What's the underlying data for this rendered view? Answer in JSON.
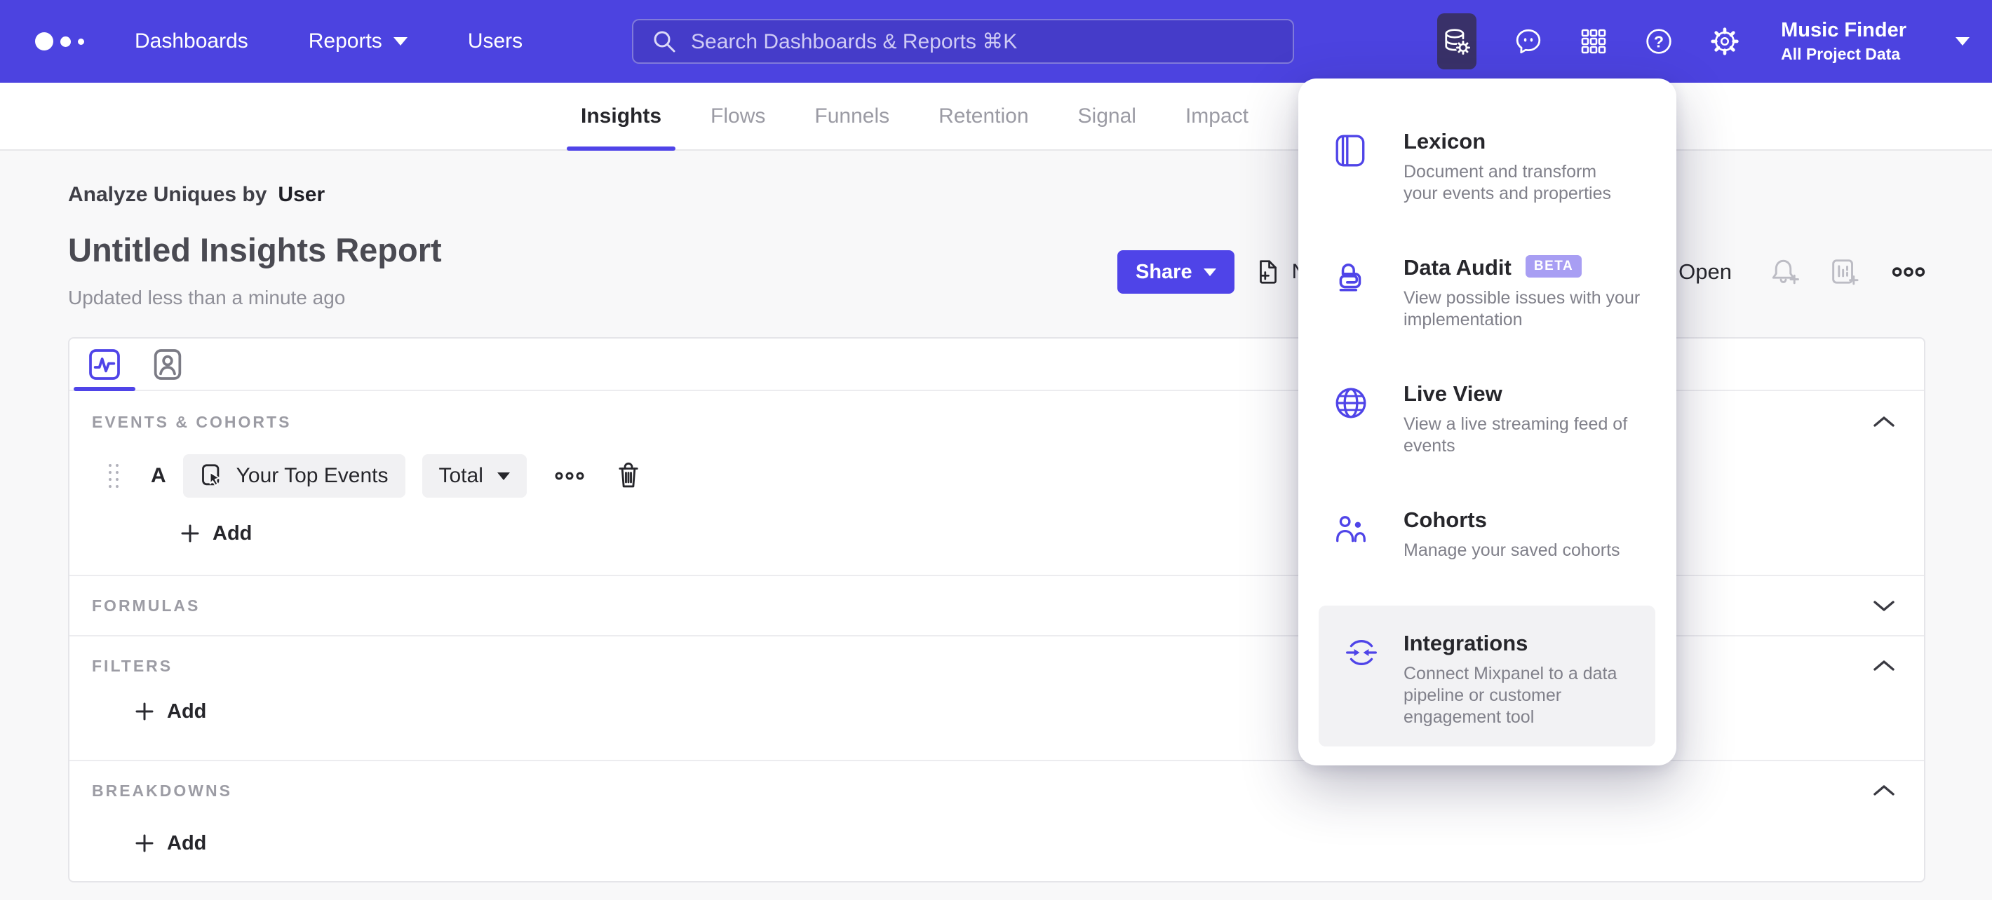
{
  "nav": {
    "items": [
      {
        "label": "Dashboards"
      },
      {
        "label": "Reports"
      },
      {
        "label": "Users"
      }
    ],
    "search_placeholder": "Search Dashboards & Reports ⌘K",
    "project": {
      "name": "Music Finder",
      "scope": "All Project Data"
    }
  },
  "icons": {
    "help_glyph": "?"
  },
  "tabs": {
    "items": [
      "Insights",
      "Flows",
      "Funnels",
      "Retention",
      "Signal",
      "Impact"
    ],
    "active": "Insights"
  },
  "report": {
    "breadcrumb_prefix": "Analyze Uniques by",
    "breadcrumb_value": "User",
    "title": "Untitled Insights Report",
    "updated": "Updated less than a minute ago"
  },
  "actions": {
    "share": "Share",
    "new_report_partial": "Ne",
    "open": "Open"
  },
  "builder": {
    "sections": {
      "events": {
        "label": "EVENTS & COHORTS",
        "collapsed": false
      },
      "formulas": {
        "label": "FORMULAS",
        "collapsed": true
      },
      "filters": {
        "label": "FILTERS",
        "collapsed": false
      },
      "breakdowns": {
        "label": "BREAKDOWNS",
        "collapsed": false
      }
    },
    "event_row": {
      "letter": "A",
      "event": "Your Top Events",
      "aggregation": "Total"
    },
    "add_label": "Add"
  },
  "menu": {
    "items": [
      {
        "title": "Lexicon",
        "desc": "Document and transform your events and properties",
        "icon": "book-icon"
      },
      {
        "title": "Data Audit",
        "badge": "BETA",
        "desc": "View possible issues with your implementation",
        "icon": "lock-audit-icon"
      },
      {
        "title": "Live View",
        "desc": "View a live streaming feed of events",
        "icon": "globe-icon"
      },
      {
        "title": "Cohorts",
        "desc": "Manage your saved cohorts",
        "icon": "cohorts-icon"
      },
      {
        "title": "Integrations",
        "desc": "Connect Mixpanel to a data pipeline or customer engagement tool",
        "icon": "integrations-icon",
        "hovered": true
      }
    ]
  },
  "colors": {
    "brand_nav": "#4c43e0",
    "brand_button": "#4f44e8",
    "nav_active_bg": "#393169",
    "search_bg": "#453cc9",
    "beta_badge": "#a89ef3",
    "text_dark": "#26262b",
    "text_gray": "#8f8f98",
    "label_gray": "#9c9ca4",
    "icon_light": "#bcbcc4",
    "border": "#e7e7ea",
    "pill_bg": "#f1f1f3",
    "page_bg": "#f8f8f9",
    "hover_item_bg": "#f2f2f4"
  }
}
